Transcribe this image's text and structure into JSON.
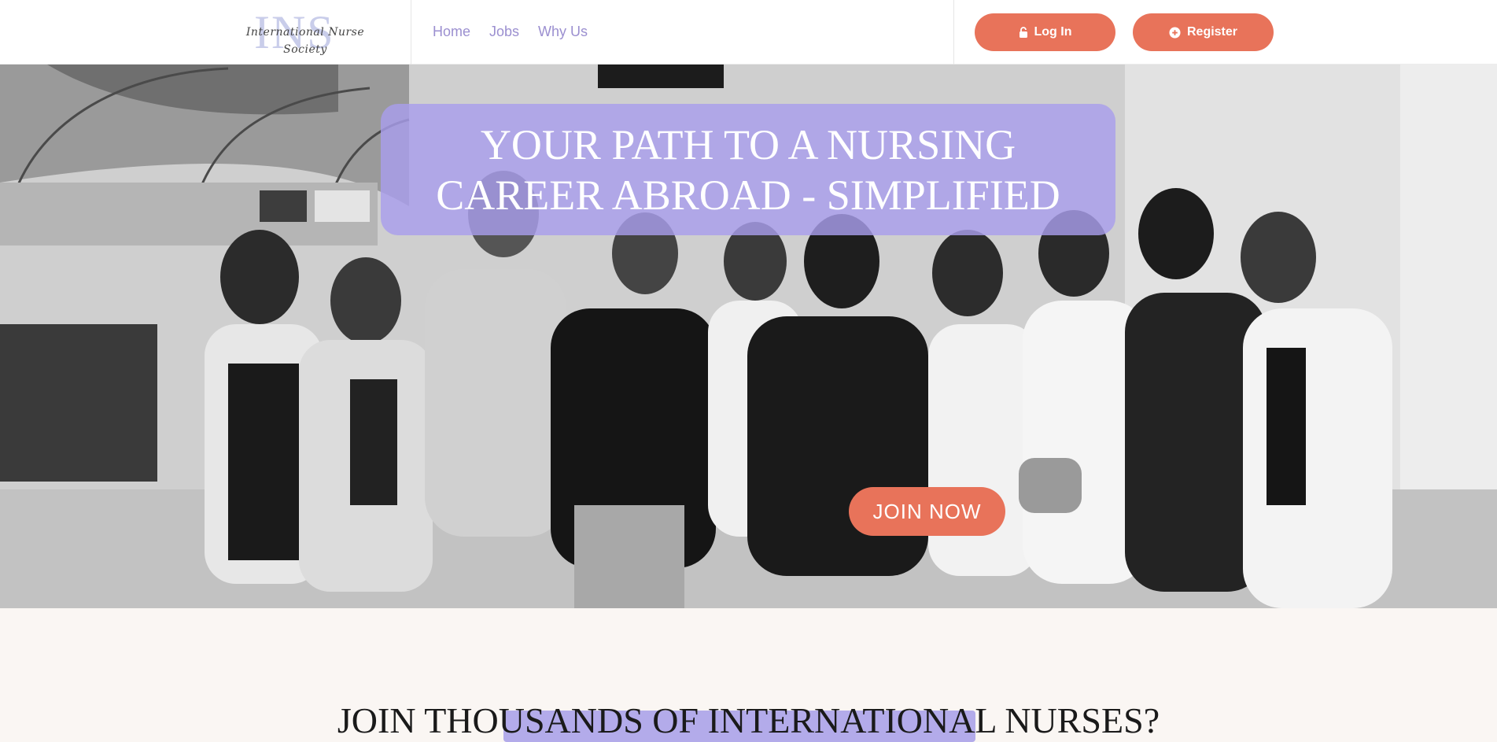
{
  "header": {
    "logo": {
      "mark": "INS",
      "script": "International Nurse Society"
    },
    "nav": [
      {
        "label": "Home"
      },
      {
        "label": "Jobs"
      },
      {
        "label": "Why Us"
      }
    ],
    "login_label": "Log In",
    "register_label": "Register"
  },
  "hero": {
    "headline": "YOUR PATH TO A NURSING CAREER ABROAD - SIMPLIFIED",
    "cta_label": "JOIN NOW",
    "photo_description_icon": "group-photo"
  },
  "section": {
    "title": "JOIN THOUSANDS OF INTERNATIONAL NURSES?"
  },
  "colors": {
    "accent": "#e8735a",
    "lavender": "#a89eec",
    "nav_text": "#9b8fd0",
    "background": "#faf6f3"
  }
}
